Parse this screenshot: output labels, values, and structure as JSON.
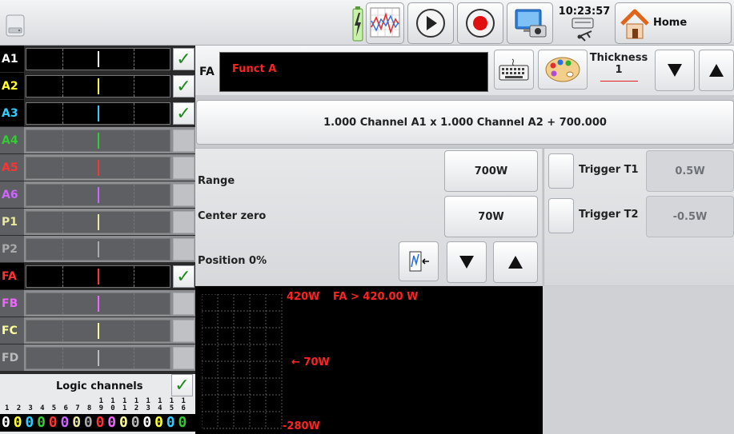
{
  "topbar": {
    "time": "10:23:57",
    "home_label": "Home"
  },
  "channels": [
    {
      "name": "A1",
      "color": "#ffffff",
      "trace": "#ffffff",
      "checked": true,
      "active": true
    },
    {
      "name": "A2",
      "color": "#ffff33",
      "trace": "#ffff33",
      "checked": true,
      "active": true
    },
    {
      "name": "A3",
      "color": "#33ccff",
      "trace": "#33ccff",
      "checked": true,
      "active": true
    },
    {
      "name": "A4",
      "color": "#33cc33",
      "trace": "#33cc33",
      "checked": false,
      "active": false
    },
    {
      "name": "A5",
      "color": "#ff3333",
      "trace": "#ff3333",
      "checked": false,
      "active": false
    },
    {
      "name": "A6",
      "color": "#cc66ff",
      "trace": "#cc66ff",
      "checked": false,
      "active": false
    },
    {
      "name": "P1",
      "color": "#e8e8a0",
      "trace": "#e8e8a0",
      "checked": false,
      "active": false
    },
    {
      "name": "P2",
      "color": "#aaaaaa",
      "trace": "#aaaaaa",
      "checked": false,
      "active": false
    },
    {
      "name": "FA",
      "color": "#ff3333",
      "trace": "#ff3333",
      "checked": true,
      "active": true
    },
    {
      "name": "FB",
      "color": "#ee66ff",
      "trace": "#ee66ff",
      "checked": false,
      "active": false
    },
    {
      "name": "FC",
      "color": "#ffff99",
      "trace": "#ffff99",
      "checked": false,
      "active": false
    },
    {
      "name": "FD",
      "color": "#bbbbbb",
      "trace": "#bbbbbb",
      "checked": false,
      "active": false
    }
  ],
  "logic": {
    "label": "Logic channels",
    "checked": true,
    "tens": [
      "",
      "",
      "",
      "",
      "",
      "",
      "",
      "",
      "1",
      "1",
      "1",
      "1",
      "1",
      "1",
      "1",
      "1"
    ],
    "units": [
      "1",
      "2",
      "3",
      "4",
      "5",
      "6",
      "7",
      "8",
      "9",
      "0",
      "1",
      "2",
      "3",
      "4",
      "5",
      "6"
    ],
    "states": [
      "0",
      "0",
      "0",
      "0",
      "0",
      "0",
      "0",
      "0",
      "0",
      "0",
      "0",
      "0",
      "0",
      "0",
      "0",
      "0"
    ],
    "state_colors": [
      "#ffffff",
      "#ffff33",
      "#33ccff",
      "#33cc33",
      "#ff3333",
      "#cc66ff",
      "#e8e8a0",
      "#aaaaaa",
      "#ff3333",
      "#ee66ff",
      "#ffff99",
      "#bbbbbb",
      "#ffffff",
      "#ffff33",
      "#33ccff",
      "#33cc33"
    ]
  },
  "function": {
    "channel_label": "FA",
    "name": "Funct A",
    "thickness_label": "Thickness 1",
    "formula": "1.000 Channel A1 x 1.000 Channel A2 + 700.000"
  },
  "settings": {
    "range_label": "Range",
    "range_value": "700W",
    "center_label": "Center zero",
    "center_value": "70W",
    "position_label": "Position 0%"
  },
  "triggers": [
    {
      "label": "Trigger T1",
      "value": "0.5W"
    },
    {
      "label": "Trigger T2",
      "value": "-0.5W"
    }
  ],
  "preview": {
    "top_label": "420W",
    "condition": "FA > 420.00 W",
    "mid_label": "← 70W",
    "bottom_label": "-280W"
  },
  "colors": {
    "accent_red": "#ff2222",
    "check_green": "#1e8b1e"
  }
}
